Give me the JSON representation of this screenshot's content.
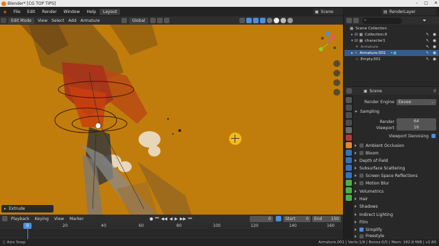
{
  "window": {
    "title": "Blender* [CG TOP TIPS]",
    "controls": [
      "–",
      "□",
      "✕"
    ]
  },
  "menu": {
    "items": [
      "File",
      "Edit",
      "Render",
      "Window",
      "Help"
    ],
    "workspace_tab": "Layout",
    "scene": "Scene",
    "render_layer": "RenderLayer"
  },
  "viewport_header": {
    "mode": "Edit Mode",
    "menus": [
      "View",
      "Select",
      "Add",
      "Armature"
    ],
    "transform_orientation": "Global"
  },
  "viewport": {
    "operator_panel": "Extrude"
  },
  "outliner": {
    "items": [
      {
        "label": "Scene Collection",
        "indent": 0,
        "selected": false,
        "icon": "collection-icon"
      },
      {
        "label": "Collection.6",
        "indent": 1,
        "selected": false,
        "icon": "collection-icon"
      },
      {
        "label": "character1",
        "indent": 1,
        "selected": false,
        "icon": "collection-icon"
      },
      {
        "label": "Armature",
        "indent": 2,
        "selected": false,
        "icon": "armature-icon"
      },
      {
        "label": "Armature.001",
        "indent": 1,
        "selected": true,
        "icon": "armature-icon"
      },
      {
        "label": "Empty.001",
        "indent": 1,
        "selected": false,
        "icon": "empty-icon"
      }
    ]
  },
  "properties": {
    "header": "Scene",
    "render_engine_label": "Render Engine",
    "render_engine": "Eevee",
    "sections": {
      "sampling": "Sampling",
      "render_label": "Render",
      "render_value": "64",
      "viewport_label": "Viewport",
      "viewport_value": "16",
      "viewport_denoising": "Viewport Denoising",
      "ambient_occlusion": "Ambient Occlusion",
      "bloom": "Bloom",
      "depth_of_field": "Depth of Field",
      "subsurface_scattering": "Subsurface Scattering",
      "screen_space_reflections": "Screen Space Reflections",
      "motion_blur": "Motion Blur",
      "volumetrics": "Volumetrics",
      "hair": "Hair",
      "shadows": "Shadows",
      "indirect_lighting": "Indirect Lighting",
      "film": "Film",
      "simplify": "Simplify",
      "freestyle": "Freestyle"
    }
  },
  "timeline": {
    "menus": [
      "Playback",
      "Keying",
      "View",
      "Marker"
    ],
    "current_frame": "0",
    "start_label": "Start",
    "start": "0",
    "end_label": "End",
    "end": "150",
    "ticks": [
      "0",
      "20",
      "40",
      "60",
      "80",
      "100",
      "120",
      "140",
      "160"
    ],
    "playhead_label": "0"
  },
  "statusbar": {
    "left": "Axis Snap",
    "right": "Armature.001 | Verts:1/6 | Bones:0/5 | Mem: 182.8 MiB | v2.80"
  },
  "colors": {
    "viewport_bg": "#c17d0c",
    "accent": "#4a8fe0",
    "selection": "#335b8e",
    "cursor": "#f5c518"
  }
}
